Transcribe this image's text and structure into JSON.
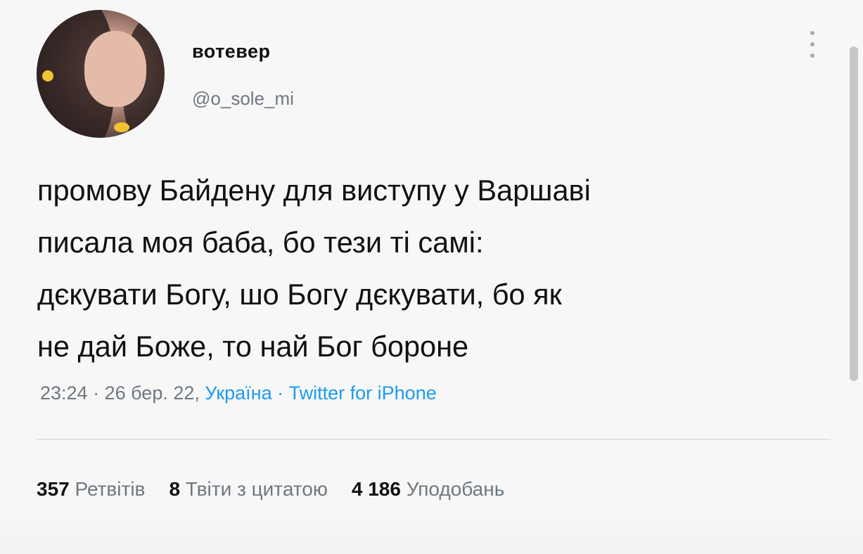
{
  "user": {
    "display_name": "вотевер",
    "handle": "@o_sole_mi"
  },
  "tweet": {
    "lines": [
      "промову Байдену для виступу у Варшаві",
      "писала моя баба, бо тези ті самі:",
      "дєкувати Богу, шо Богу дєкувати, бо як",
      "не дай Боже, то най Бог бороне"
    ],
    "time": "23:24",
    "sep1": "·",
    "date": "26 бер. 22,",
    "location": "Україна",
    "sep2": "·",
    "source": "Twitter for iPhone"
  },
  "stats": {
    "retweets_count": "357",
    "retweets_label": "Ретвітів",
    "quotes_count": "8",
    "quotes_label": "Твіти з цитатою",
    "likes_count": "4 186",
    "likes_label": "Уподобань"
  },
  "icons": {
    "more": "more-vertical-icon"
  },
  "colors": {
    "link": "#1d9bf0",
    "secondary_text": "#6f7780",
    "primary_text": "#111111"
  }
}
